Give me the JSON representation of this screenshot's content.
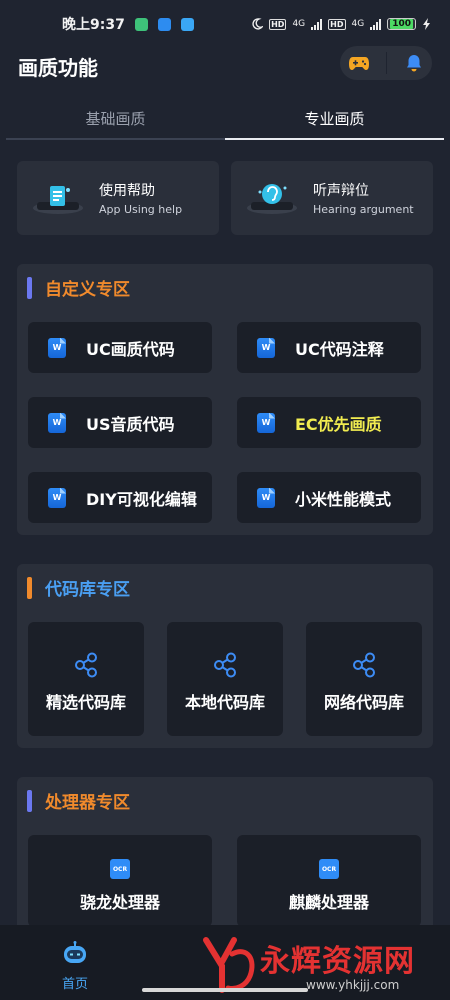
{
  "status_bar": {
    "time": "晚上9:37",
    "hd_1": "HD",
    "net_1": "4G",
    "hd_2": "HD",
    "net_2": "4G",
    "battery": "100"
  },
  "header": {
    "title": "画质功能"
  },
  "tabs": [
    {
      "label": "基础画质",
      "active": false
    },
    {
      "label": "专业画质",
      "active": true
    }
  ],
  "help_cards": [
    {
      "title": "使用帮助",
      "subtitle": "App Using help"
    },
    {
      "title": "听声辩位",
      "subtitle": "Hearing argument"
    }
  ],
  "custom_zone": {
    "title": "自定义专区",
    "bar_color": "#6b78f0",
    "title_color": "#f08a2c",
    "buttons": [
      {
        "label": "UC画质代码",
        "icon": "word-doc-icon"
      },
      {
        "label": "UC代码注释",
        "icon": "word-doc-icon"
      },
      {
        "label": "US音质代码",
        "icon": "word-doc-icon"
      },
      {
        "label": "EC优先画质",
        "icon": "word-doc-icon",
        "highlight_color": "#f1ec50"
      },
      {
        "label": "DIY可视化编辑",
        "icon": "word-doc-icon"
      },
      {
        "label": "小米性能模式",
        "icon": "word-doc-icon"
      }
    ]
  },
  "code_lib_zone": {
    "title": "代码库专区",
    "bar_color": "#f08a2c",
    "title_color": "#4a9ff2",
    "items": [
      {
        "label": "精选代码库",
        "icon": "share-icon"
      },
      {
        "label": "本地代码库",
        "icon": "share-icon"
      },
      {
        "label": "网络代码库",
        "icon": "share-icon"
      }
    ]
  },
  "processor_zone": {
    "title": "处理器专区",
    "bar_color": "#6b78f0",
    "title_color": "#f08a2c",
    "items": [
      {
        "label": "骁龙处理器",
        "icon": "chip-icon",
        "chip_text": "OCR"
      },
      {
        "label": "麒麟处理器",
        "icon": "chip-icon",
        "chip_text": "OCR"
      }
    ]
  },
  "bottom_nav": {
    "home_label": "首页"
  },
  "watermark": {
    "text": "永辉资源网",
    "url": "www.yhkjjj.com"
  }
}
